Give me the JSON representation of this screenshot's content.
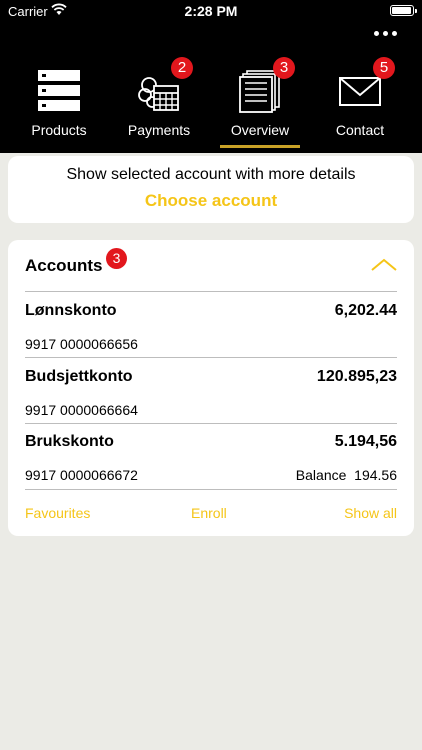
{
  "status_bar": {
    "carrier": "Carrier",
    "time": "2:28 PM"
  },
  "nav": {
    "tabs": [
      {
        "label": "Products",
        "icon": "server-stack-icon",
        "badge": ""
      },
      {
        "label": "Payments",
        "icon": "calendar-payments-icon",
        "badge": "2"
      },
      {
        "label": "Overview",
        "icon": "documents-overview-icon",
        "badge": "3",
        "active": true
      },
      {
        "label": "Contact",
        "icon": "envelope-icon",
        "badge": "5"
      }
    ]
  },
  "choose_account": {
    "title": "Show selected account with more details",
    "link": "Choose account"
  },
  "accounts": {
    "title": "Accounts",
    "badge": "3",
    "rows": [
      {
        "name": "Lønnskonto",
        "amount": "6,202.44",
        "number": "9917 0000066656",
        "balance_label": "",
        "balance_value": ""
      },
      {
        "name": "Budsjettkonto",
        "amount": "120.895,23",
        "number": "9917 0000066664",
        "balance_label": "",
        "balance_value": ""
      },
      {
        "name": "Brukskonto",
        "amount": "5.194,56",
        "number": "9917 0000066672",
        "balance_label": "Balance",
        "balance_value": "194.56"
      }
    ],
    "footer": {
      "favourites": "Favourites",
      "enroll": "Enroll",
      "show_all": "Show all"
    }
  },
  "colors": {
    "accent": "#f5c518",
    "badge": "#e2171d",
    "tab_indicator": "#c9a227",
    "header": "#000000",
    "background": "#ebebe6"
  }
}
